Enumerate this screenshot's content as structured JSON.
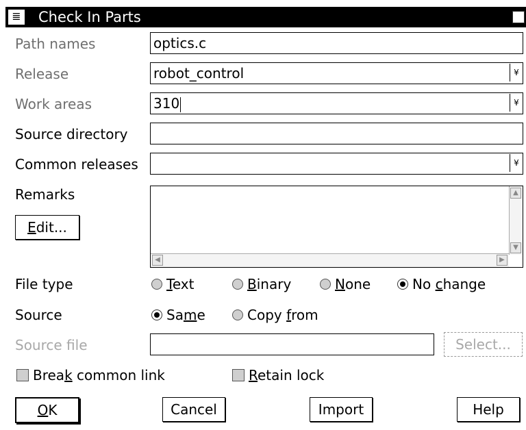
{
  "window": {
    "title": "Check In Parts",
    "sysmenu_glyph": "≣"
  },
  "labels": {
    "path_names": "Path names",
    "release": "Release",
    "work_areas": "Work areas",
    "source_directory": "Source directory",
    "common_releases": "Common releases",
    "remarks": "Remarks",
    "file_type": "File type",
    "source": "Source",
    "source_file": "Source file"
  },
  "fields": {
    "path_names": "optics.c",
    "release": "robot_control",
    "work_areas": "310",
    "source_directory": "",
    "common_releases": "",
    "source_file": ""
  },
  "buttons": {
    "edit": {
      "pre": "",
      "u": "E",
      "post": "dit..."
    },
    "select": "Select...",
    "ok": {
      "pre": "",
      "u": "O",
      "post": "K"
    },
    "cancel": "Cancel",
    "import": "Import",
    "help": "Help"
  },
  "file_type_options": {
    "text": {
      "pre": "",
      "u": "T",
      "post": "ext",
      "selected": false
    },
    "binary": {
      "pre": "",
      "u": "B",
      "post": "inary",
      "selected": false
    },
    "none": {
      "pre": "",
      "u": "N",
      "post": "one",
      "selected": false
    },
    "no_change": {
      "pre": "No ",
      "u": "c",
      "post": "hange",
      "selected": true
    }
  },
  "source_options": {
    "same": {
      "pre": "Sa",
      "u": "m",
      "post": "e",
      "selected": true
    },
    "copy_from": {
      "pre": "Copy ",
      "u": "f",
      "post": "rom",
      "selected": false
    }
  },
  "checkboxes": {
    "break_common_link": {
      "pre": "Brea",
      "u": "k",
      "post": " common link",
      "checked": false
    },
    "retain_lock": {
      "pre": "",
      "u": "R",
      "post": "etain lock",
      "checked": false
    }
  },
  "icons": {
    "dropdown": "¥",
    "scroll_up": "▲",
    "scroll_down": "▼",
    "scroll_left": "◀",
    "scroll_right": "▶"
  },
  "colors": {
    "titlebar": "#000000",
    "label_dim": "#6f6f6f",
    "disabled": "#a8a8a8"
  }
}
